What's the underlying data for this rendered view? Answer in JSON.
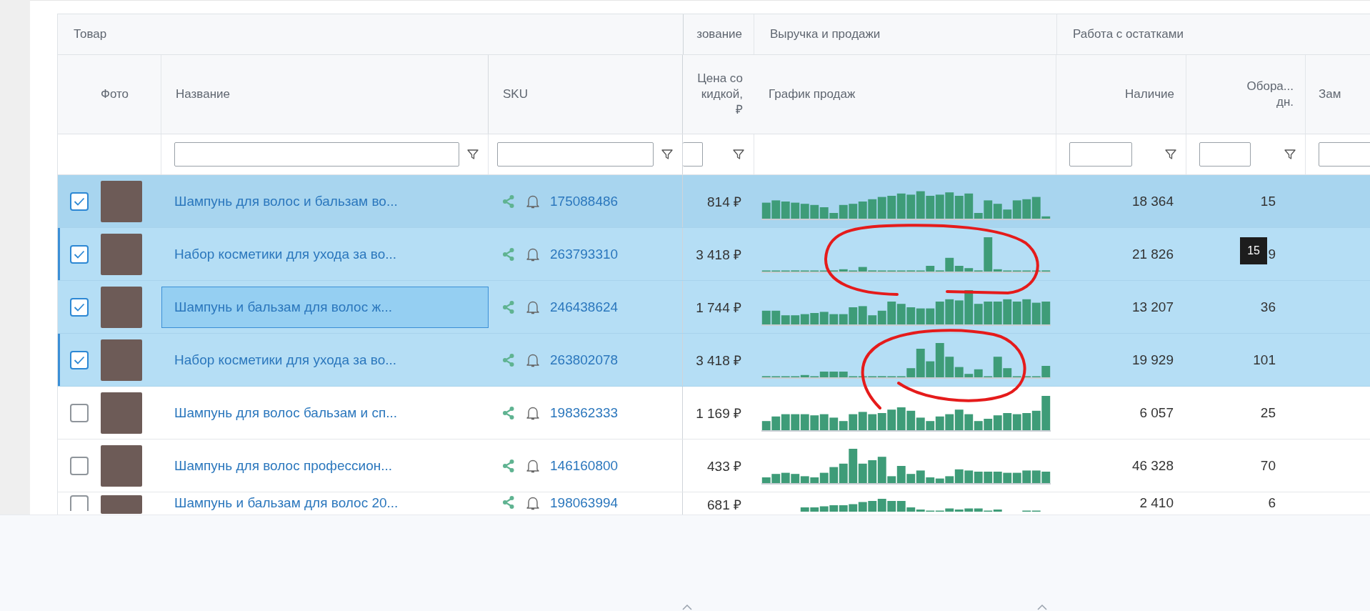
{
  "groups": [
    {
      "label": "Товар",
      "columns": [
        {
          "kind": "check"
        },
        {
          "kind": "photo",
          "label": "Фото"
        },
        {
          "kind": "name",
          "label": "Название"
        },
        {
          "kind": "sku",
          "label": "SKU"
        }
      ]
    },
    {
      "label": "зование",
      "columns": [
        {
          "kind": "price",
          "label": "Цена со кидкой, ₽"
        }
      ]
    },
    {
      "label": "Выручка и продажи",
      "columns": [
        {
          "kind": "chart",
          "label": "График продаж"
        }
      ]
    },
    {
      "label": "Работа с остатками",
      "columns": [
        {
          "kind": "stock",
          "label": "Наличие"
        },
        {
          "kind": "turnover",
          "label": "Обора... дн."
        },
        {
          "kind": "cut",
          "label": "Зам"
        }
      ]
    }
  ],
  "rows": [
    {
      "checked": true,
      "selected": true,
      "hovered": true,
      "marked": false,
      "focused": false,
      "name": "Шампунь для волос и бальзам во...",
      "sku": "175088486",
      "price": "814 ₽",
      "stock": "18 364",
      "turnover": "15"
    },
    {
      "checked": true,
      "selected": true,
      "hovered": false,
      "marked": true,
      "focused": false,
      "name": "Набор косметики для ухода за во...",
      "sku": "263793310",
      "price": "3 418 ₽",
      "stock": "21 826",
      "turnover": "9",
      "tooltip": "15"
    },
    {
      "checked": true,
      "selected": true,
      "hovered": false,
      "marked": false,
      "focused": true,
      "name": "Шампунь и бальзам для волос ж...",
      "sku": "246438624",
      "price": "1 744 ₽",
      "stock": "13 207",
      "turnover": "36"
    },
    {
      "checked": true,
      "selected": true,
      "hovered": false,
      "marked": true,
      "focused": false,
      "name": "Набор косметики для ухода за во...",
      "sku": "263802078",
      "price": "3 418 ₽",
      "stock": "19 929",
      "turnover": "101"
    },
    {
      "checked": false,
      "selected": false,
      "hovered": false,
      "marked": false,
      "focused": false,
      "name": "Шампунь для волос бальзам и сп...",
      "sku": "198362333",
      "price": "1 169 ₽",
      "stock": "6 057",
      "turnover": "25"
    },
    {
      "checked": false,
      "selected": false,
      "hovered": false,
      "marked": false,
      "focused": false,
      "name": "Шампунь для волос профессион...",
      "sku": "146160800",
      "price": "433 ₽",
      "stock": "46 328",
      "turnover": "70"
    },
    {
      "checked": false,
      "selected": false,
      "hovered": false,
      "marked": false,
      "focused": false,
      "name": "Шампунь и бальзам для волос 20...",
      "sku": "198063994",
      "price": "681 ₽",
      "stock": "2 410",
      "turnover": "6"
    }
  ]
}
